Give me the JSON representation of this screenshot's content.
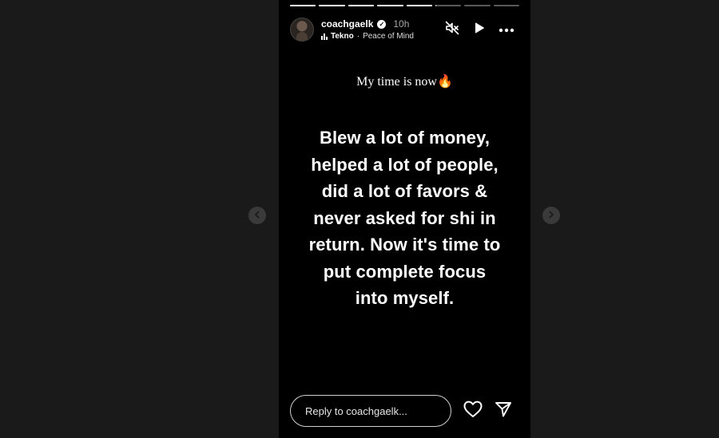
{
  "story": {
    "progress": [
      1,
      1,
      1,
      1,
      1,
      0.05,
      0,
      0
    ],
    "user": {
      "username": "coachgaelk",
      "verified": true,
      "time": "10h"
    },
    "music": {
      "artist": "Tekno",
      "separator": "·",
      "song": "Peace of Mind"
    },
    "controls": {
      "mute_icon": "speaker-muted-icon",
      "play_icon": "play-icon",
      "more_icon": "more-horizontal-icon"
    },
    "caption": "My time is now🔥",
    "main_text": "Blew a lot of money,\nhelped a lot of people,\ndid a lot of favors &\nnever asked for shi in\nreturn. Now it's time to\nput complete focus\ninto myself.",
    "reply": {
      "placeholder": "Reply to coachgaelk...",
      "value": ""
    },
    "actions": {
      "like_icon": "heart-icon",
      "share_icon": "send-icon"
    }
  },
  "navigation": {
    "prev_icon": "chevron-left-icon",
    "next_icon": "chevron-right-icon"
  },
  "colors": {
    "page_bg": "#1a1a1a",
    "story_bg": "#000000",
    "text": "#ffffff",
    "muted_text": "#a8a8a8"
  }
}
